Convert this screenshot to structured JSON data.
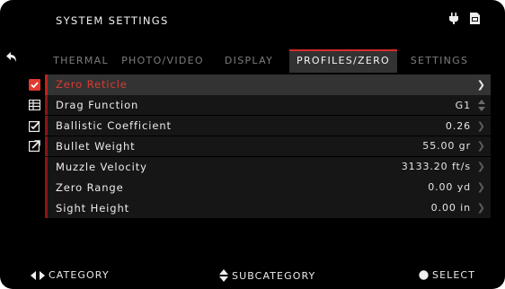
{
  "header": {
    "title": "SYSTEM SETTINGS"
  },
  "tabs": [
    {
      "label": "THERMAL",
      "active": false
    },
    {
      "label": "PHOTO/VIDEO",
      "active": false
    },
    {
      "label": "DISPLAY",
      "active": false
    },
    {
      "label": "PROFILES/ZERO",
      "active": true
    },
    {
      "label": "SETTINGS",
      "active": false
    }
  ],
  "rows": [
    {
      "label": "Zero Reticle",
      "value": "",
      "icon": "reticle-check-icon",
      "selected": true,
      "control": "chevron"
    },
    {
      "label": "Drag Function",
      "value": "G1",
      "icon": "table-icon",
      "selected": false,
      "control": "updown"
    },
    {
      "label": "Ballistic Coefficient",
      "value": "0.26",
      "icon": "edit-check-icon",
      "selected": false,
      "control": "chevron"
    },
    {
      "label": "Bullet Weight",
      "value": "55.00 gr",
      "icon": "export-icon",
      "selected": false,
      "control": "chevron"
    },
    {
      "label": "Muzzle Velocity",
      "value": "3133.20 ft/s",
      "icon": "",
      "selected": false,
      "control": "chevron"
    },
    {
      "label": "Zero Range",
      "value": "0.00 yd",
      "icon": "",
      "selected": false,
      "control": "chevron"
    },
    {
      "label": "Sight Height",
      "value": "0.00 in",
      "icon": "",
      "selected": false,
      "control": "chevron"
    }
  ],
  "footer": {
    "category": "CATEGORY",
    "subcategory": "SUBCATEGORY",
    "select": "SELECT"
  },
  "colors": {
    "accent": "#d72a2a",
    "background": "#000000",
    "selected_row": "#333333"
  }
}
